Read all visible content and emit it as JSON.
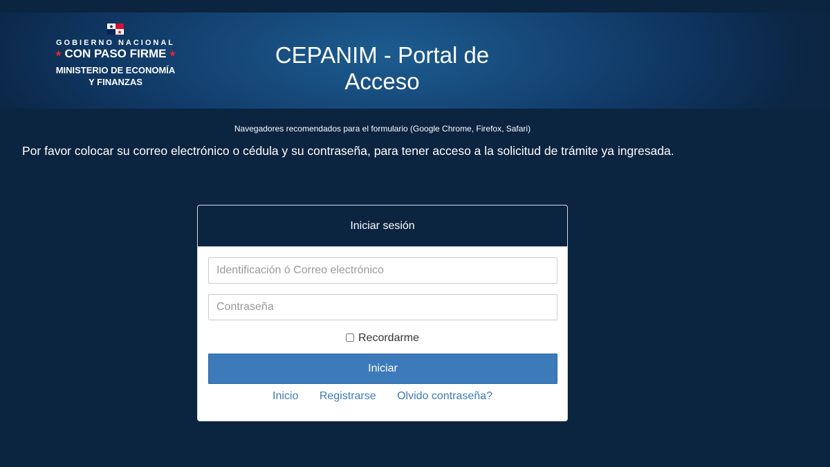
{
  "header": {
    "logo": {
      "line1": "GOBIERNO NACIONAL",
      "line2": "CON PASO FIRME",
      "line3": "MINISTERIO DE ECONOMÍA",
      "line4": "Y FINANZAS"
    },
    "title": "CEPANIM - Portal de Acceso"
  },
  "notice": {
    "browsers": "Navegadores recomendados para el formulario (Google Chrome, Firefox, Safari)",
    "instructions": "Por favor colocar su correo electrónico o cédula y su contraseña, para tener acceso a la solicitud de trámite ya ingresada."
  },
  "login": {
    "title": "Iniciar sesión",
    "identification_placeholder": "Identificación ó Correo electrónico",
    "identification_value": "",
    "password_placeholder": "Contraseña",
    "password_value": "",
    "remember_label": "Recordarme",
    "remember_checked": false,
    "submit_label": "Iniciar",
    "links": {
      "home": "Inicio",
      "register": "Registrarse",
      "forgot": "Olvido contraseña?"
    }
  },
  "colors": {
    "background": "#0b2440",
    "primary_button": "#3d7ab9",
    "link": "#3d7ab9",
    "flag_red": "#d21034",
    "flag_blue": "#072357"
  },
  "icons": [
    "panama-flag-icon",
    "star-icon"
  ]
}
